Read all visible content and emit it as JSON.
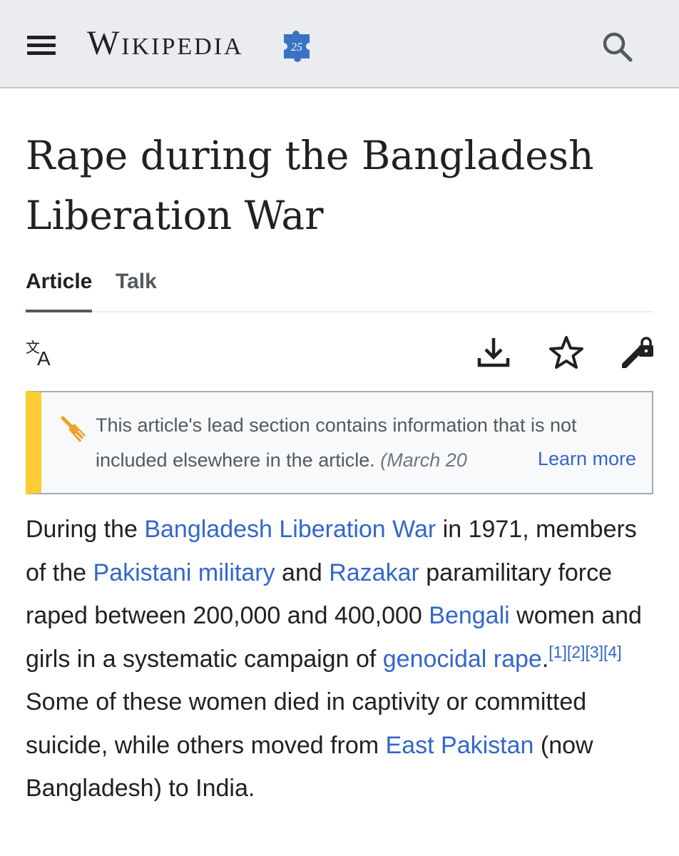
{
  "header": {
    "wordmark": "Wikipedia",
    "logo_badge": "25",
    "menu_icon": "hamburger-menu-icon",
    "search_icon": "search-icon"
  },
  "page": {
    "title": "Rape during the Bangladesh Liberation War"
  },
  "tabs": [
    {
      "label": "Article",
      "active": true
    },
    {
      "label": "Talk",
      "active": false
    }
  ],
  "toolbar": {
    "language_icon": "language-icon",
    "download_icon": "download-icon",
    "watch_icon": "star-icon",
    "edit_icon": "edit-locked-icon"
  },
  "notice": {
    "icon": "broom-icon",
    "text": "This article's lead section contains information that is not included elsewhere in the article.",
    "date": "(March 20",
    "learn_more": "Learn more"
  },
  "body": {
    "t1": "During the ",
    "l1": "Bangladesh Liberation War",
    "t2": " in 1971, members of the ",
    "l2": "Pakistani military",
    "t3": " and ",
    "l3": "Razakar",
    "t4": " paramilitary force raped between 200,000 and 400,000 ",
    "l4": "Bengali",
    "t5": " women and girls in a systematic campaign of ",
    "l5": "genocidal rape",
    "t6": ".",
    "refs": [
      "[1]",
      "[2]",
      "[3]",
      "[4]"
    ],
    "t7": " Some of these women died in captivity or committed suicide, while others moved from ",
    "l6": "East Pakistan",
    "t8": " (now Bangladesh) to India."
  },
  "colors": {
    "link": "#3366cc",
    "header_bg": "#eaecf0",
    "notice_stripe": "#ffcc33",
    "text": "#202122"
  }
}
